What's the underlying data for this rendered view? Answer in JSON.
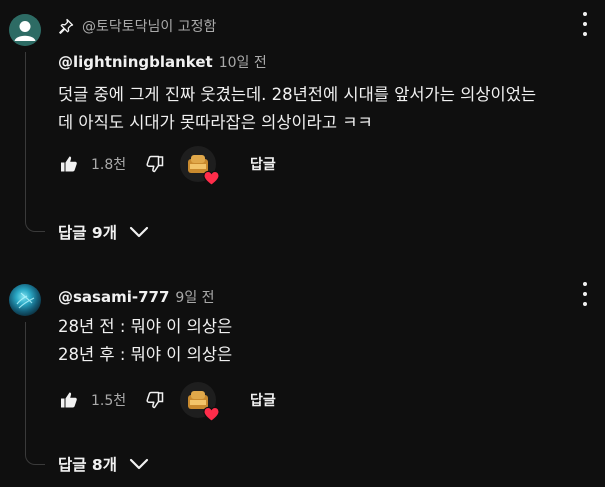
{
  "comments": [
    {
      "pinned_label": "@토닥토닥님이 고정함",
      "author": "@lightningblanket",
      "time": "10일 전",
      "text": "덧글 중에 그게 진짜 웃겼는데. 28년전에 시대를 앞서가는 의상이었는\n데 아직도 시대가 못따라잡은 의상이라고 ㅋㅋ",
      "likes": "1.8천",
      "reply_label": "답글",
      "replies_label": "답글 9개",
      "avatar_icon": "default-avatar-icon"
    },
    {
      "author": "@sasami-777",
      "time": "9일 전",
      "text": "28년 전 : 뭐야 이 의상은\n28년 후 : 뭐야 이 의상은",
      "likes": "1.5천",
      "reply_label": "답글",
      "replies_label": "답글 8개",
      "avatar_icon": "blue-glow-avatar"
    }
  ],
  "colors": {
    "background": "#0f0f0f",
    "text_primary": "#f1f1f1",
    "text_secondary": "#aaaaaa",
    "heart": "#ff2d4a"
  }
}
